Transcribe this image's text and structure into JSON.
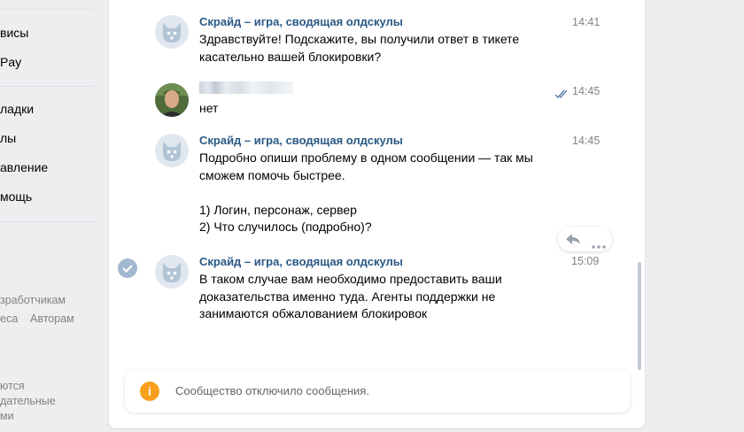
{
  "sidebar": {
    "items": [
      "висы",
      "Pay",
      "ладки",
      "лы",
      "авление",
      "мощь"
    ],
    "footer_links": [
      "зработчикам",
      "еса",
      "Авторам"
    ],
    "footer_text": [
      "ются",
      "дательные",
      "ми"
    ]
  },
  "messages": [
    {
      "author": "Скрайд – игра, сводящая олдскулы",
      "time": "14:41",
      "text": "Здравствуйте! Подскажите, вы получили ответ в тикете\nкасательно вашей блокировки?",
      "avatar_icon": "dog-avatar-icon"
    },
    {
      "author": "",
      "time": "14:45",
      "text": "нет",
      "read_status_icon": "double-check-icon",
      "avatar_icon": "user-photo-avatar"
    },
    {
      "author": "Скрайд – игра, сводящая олдскулы",
      "time": "14:45",
      "text": "Подробно опиши проблему в одном сообщении — так мы\nсможем помочь быстрее.\n\n1) Логин, персонаж, сервер\n2) Что случилось (подробно)?",
      "avatar_icon": "dog-avatar-icon"
    },
    {
      "author": "Скрайд – игра, сводящая олдскулы",
      "time": "15:09",
      "text": "В таком случае вам необходимо предоставить ваши\nдоказательства именно туда. Агенты поддержки не\nзанимаются обжалованием блокировок",
      "avatar_icon": "dog-avatar-icon"
    }
  ],
  "notice": {
    "icon": "info-icon",
    "icon_glyph": "i",
    "text": "Сообщество отключило сообщения."
  },
  "colors": {
    "author": "#2a5885",
    "time": "#828282",
    "notice_icon": "#f8a01c",
    "background": "#edeef0"
  }
}
